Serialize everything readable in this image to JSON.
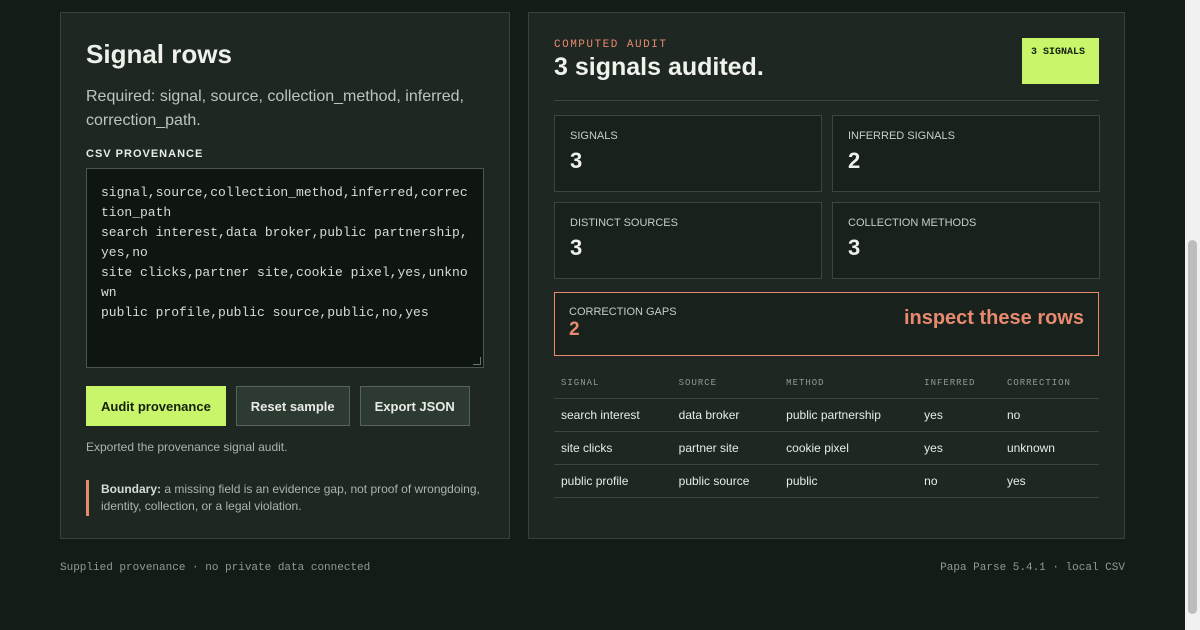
{
  "left": {
    "title": "Signal rows",
    "required": "Required: signal, source, collection_method, inferred, correction_path.",
    "csv_label": "CSV PROVENANCE",
    "csv_lines": [
      "signal,source,collection_method,inferred,correction_path",
      "search interest,data broker,public partnership,yes,no",
      "site clicks,partner site,cookie pixel,yes,unknown",
      "public profile,public source,public,no,yes"
    ],
    "buttons": {
      "audit": "Audit provenance",
      "reset": "Reset sample",
      "export": "Export JSON"
    },
    "status": "Exported the provenance signal audit.",
    "boundary_label": "Boundary:",
    "boundary_text": " a missing field is an evidence gap, not proof of wrongdoing, identity, collection, or a legal violation."
  },
  "right": {
    "kicker": "COMPUTED AUDIT",
    "title": "3 signals audited.",
    "badge": "3 SIGNALS",
    "stats": [
      {
        "label": "SIGNALS",
        "value": "3"
      },
      {
        "label": "INFERRED SIGNALS",
        "value": "2"
      },
      {
        "label": "DISTINCT SOURCES",
        "value": "3"
      },
      {
        "label": "COLLECTION METHODS",
        "value": "3"
      }
    ],
    "gaps": {
      "label": "CORRECTION GAPS",
      "value": "2",
      "note": "inspect these rows"
    },
    "table": {
      "headers": [
        "SIGNAL",
        "SOURCE",
        "METHOD",
        "INFERRED",
        "CORRECTION"
      ],
      "rows": [
        [
          "search interest",
          "data broker",
          "public partnership",
          "yes",
          "no"
        ],
        [
          "site clicks",
          "partner site",
          "cookie pixel",
          "yes",
          "unknown"
        ],
        [
          "public profile",
          "public source",
          "public",
          "no",
          "yes"
        ]
      ]
    }
  },
  "footer": {
    "left": "Supplied provenance · no private data connected",
    "right": "Papa Parse 5.4.1 · local CSV"
  },
  "colors": {
    "accent": "#c9f56a",
    "warning": "#e88a6f",
    "background": "#141c18"
  }
}
